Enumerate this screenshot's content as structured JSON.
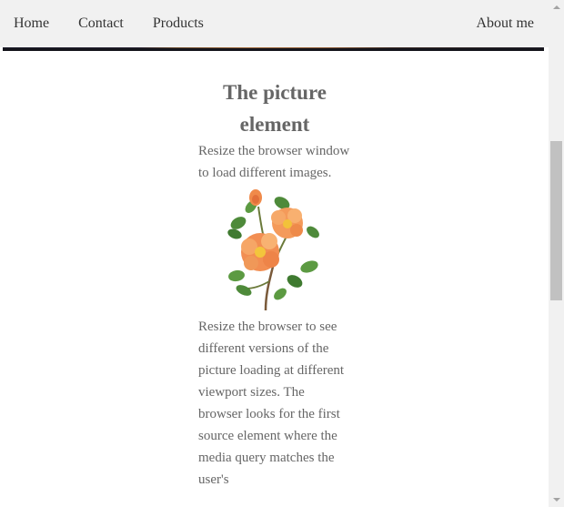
{
  "nav": {
    "home": "Home",
    "contact": "Contact",
    "products": "Products",
    "about": "About me"
  },
  "main": {
    "title": "The picture element",
    "intro": "Resize the browser window to load different images.",
    "body": "Resize the browser to see different versions of the picture loading at different viewport sizes. The browser looks for the first source element where the media query matches the user's"
  },
  "icons": {
    "flower": "rose-illustration"
  },
  "colors": {
    "nav_bg": "#f1f1f1",
    "text": "#666666",
    "nav_text": "#333333",
    "scrollbar_thumb": "#c1c1c1"
  }
}
